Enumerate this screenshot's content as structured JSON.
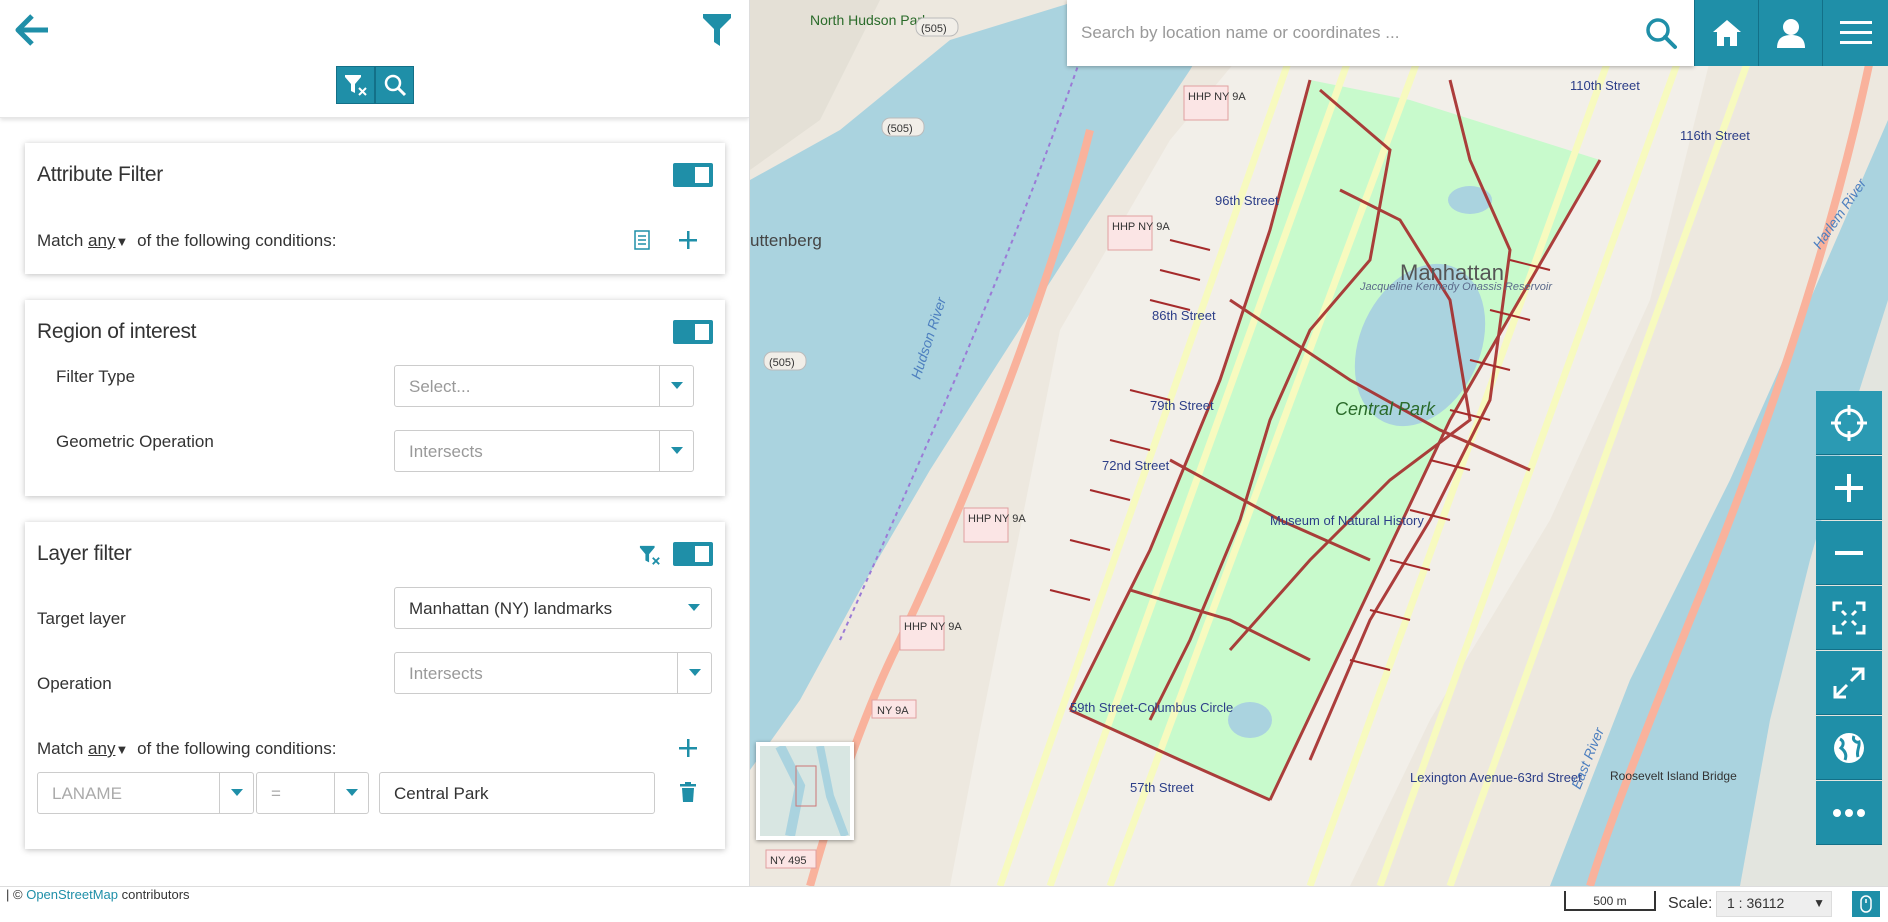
{
  "panel": {
    "attribute_filter": {
      "title": "Attribute Filter",
      "match_prefix": "Match",
      "match_value": "any",
      "match_suffix": "of the following conditions:"
    },
    "region_of_interest": {
      "title": "Region of interest",
      "filter_type_label": "Filter Type",
      "filter_type_placeholder": "Select...",
      "geometric_operation_label": "Geometric Operation",
      "geometric_operation_value": "Intersects"
    },
    "layer_filter": {
      "title": "Layer filter",
      "target_layer_label": "Target layer",
      "target_layer_value": "Manhattan (NY) landmarks",
      "operation_label": "Operation",
      "operation_value": "Intersects",
      "match_prefix": "Match",
      "match_value": "any",
      "match_suffix": "of the following conditions:",
      "condition": {
        "attribute_placeholder": "LANAME",
        "operator_placeholder": "=",
        "value": "Central Park"
      }
    }
  },
  "search": {
    "placeholder": "Search by location name or coordinates ..."
  },
  "map": {
    "labels": {
      "central_park": "Central Park",
      "manhattan": "Manhattan",
      "reservoir": "Jacqueline Kennedy Onassis Reservoir",
      "north_hudson": "North Hudson Park",
      "guttenberg": "uttenberg",
      "hudson_river": "Hudson River",
      "east_river": "East River",
      "harlem_river": "Harlem River",
      "roosevelt_bridge": "Roosevelt Island Bridge",
      "museum": "Museum of Natural History",
      "st_72": "72nd Street",
      "st_86": "86th Street",
      "st_96": "96th Street",
      "st_79": "79th Street",
      "st_110": "110th Street",
      "st_116": "116th Street",
      "st_59": "59th Street-Columbus Circle",
      "st_57": "57th Street",
      "lexington": "Lexington Avenue-63rd Street",
      "route_505": "(505)",
      "hhp": "HHP NY 9A",
      "ny9a": "NY 9A",
      "ny495": "NY 495"
    }
  },
  "footer": {
    "attribution_prefix": "| ©",
    "attribution_link": "OpenStreetMap",
    "attribution_suffix": "contributors",
    "scalebar": "500 m",
    "scale_label": "Scale:",
    "scale_value": "1 : 36112"
  },
  "colors": {
    "accent": "#1f8fa8",
    "highlight": "#a52a2a",
    "park": "#c8facc",
    "water": "#aad3df"
  }
}
